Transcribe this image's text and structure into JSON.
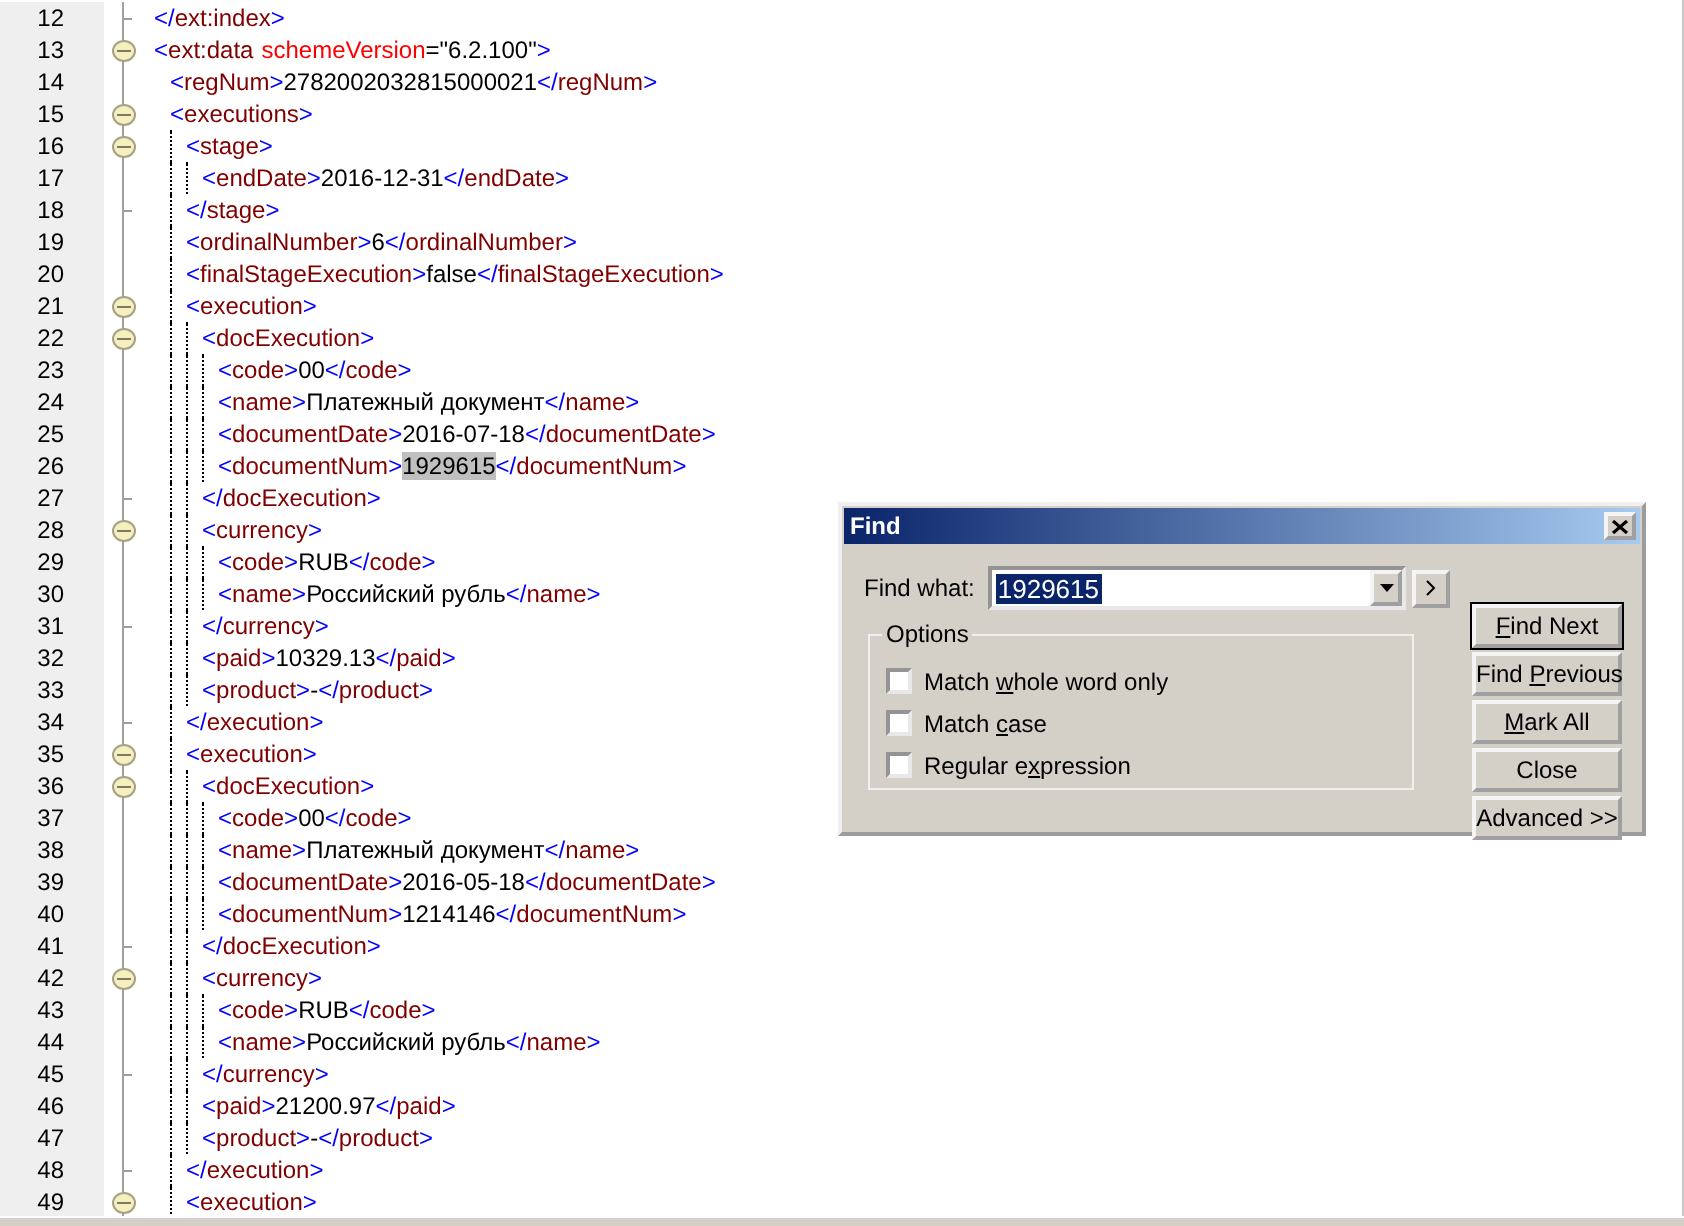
{
  "editor": {
    "lines": [
      {
        "number": "12",
        "kind": "end",
        "tokens": [
          {
            "kind": "bracket",
            "text": "</"
          },
          {
            "kind": "tag",
            "text": "ext:index"
          },
          {
            "kind": "bracket",
            "text": ">"
          }
        ]
      },
      {
        "number": "13",
        "kind": "block",
        "tokens": [
          {
            "kind": "bracket",
            "text": "<"
          },
          {
            "kind": "tag",
            "text": "ext:data"
          },
          {
            "kind": "attribute",
            "text": "schemeVersion"
          },
          {
            "kind": "value",
            "text": "=\"6.2.100\""
          },
          {
            "kind": "bracket",
            "text": ">"
          }
        ],
        "children": [
          {
            "number": "14",
            "kind": "line",
            "tokens": [
              {
                "kind": "bracket",
                "text": "<"
              },
              {
                "kind": "tag",
                "text": "regNum"
              },
              {
                "kind": "bracket",
                "text": ">"
              },
              {
                "kind": "text",
                "text": "2782002032815000021"
              },
              {
                "kind": "bracket",
                "text": "</"
              },
              {
                "kind": "tag",
                "text": "regNum"
              },
              {
                "kind": "bracket",
                "text": ">"
              }
            ]
          },
          {
            "number": "15",
            "kind": "block",
            "tokens": [
              {
                "kind": "bracket",
                "text": "<"
              },
              {
                "kind": "tag",
                "text": "executions"
              },
              {
                "kind": "bracket",
                "text": ">"
              }
            ],
            "children": [
              {
                "number": "16",
                "kind": "block",
                "tokens": [
                  {
                    "kind": "bracket",
                    "text": "<"
                  },
                  {
                    "kind": "tag",
                    "text": "stage"
                  },
                  {
                    "kind": "bracket",
                    "text": ">"
                  }
                ],
                "children": [
                  {
                    "number": "17",
                    "kind": "line",
                    "tokens": [
                      {
                        "kind": "bracket",
                        "text": "<"
                      },
                      {
                        "kind": "tag",
                        "text": "endDate"
                      },
                      {
                        "kind": "bracket",
                        "text": ">"
                      },
                      {
                        "kind": "text",
                        "text": "2016-12-31"
                      },
                      {
                        "kind": "bracket",
                        "text": "</"
                      },
                      {
                        "kind": "tag",
                        "text": "endDate"
                      },
                      {
                        "kind": "bracket",
                        "text": ">"
                      }
                    ]
                  }
                ],
                "close": {
                  "number": "18",
                  "kind": "end",
                  "tokens": [
                    {
                      "kind": "bracket",
                      "text": "</"
                    },
                    {
                      "kind": "tag",
                      "text": "stage"
                    },
                    {
                      "kind": "bracket",
                      "text": ">"
                    }
                  ]
                }
              },
              {
                "number": "19",
                "kind": "line",
                "tokens": [
                  {
                    "kind": "bracket",
                    "text": "<"
                  },
                  {
                    "kind": "tag",
                    "text": "ordinalNumber"
                  },
                  {
                    "kind": "bracket",
                    "text": ">"
                  },
                  {
                    "kind": "text",
                    "text": "6"
                  },
                  {
                    "kind": "bracket",
                    "text": "</"
                  },
                  {
                    "kind": "tag",
                    "text": "ordinalNumber"
                  },
                  {
                    "kind": "bracket",
                    "text": ">"
                  }
                ]
              },
              {
                "number": "20",
                "kind": "line",
                "tokens": [
                  {
                    "kind": "bracket",
                    "text": "<"
                  },
                  {
                    "kind": "tag",
                    "text": "finalStageExecution"
                  },
                  {
                    "kind": "bracket",
                    "text": ">"
                  },
                  {
                    "kind": "text",
                    "text": "false"
                  },
                  {
                    "kind": "bracket",
                    "text": "</"
                  },
                  {
                    "kind": "tag",
                    "text": "finalStageExecution"
                  },
                  {
                    "kind": "bracket",
                    "text": ">"
                  }
                ]
              },
              {
                "number": "21",
                "kind": "block",
                "tokens": [
                  {
                    "kind": "bracket",
                    "text": "<"
                  },
                  {
                    "kind": "tag",
                    "text": "execution"
                  },
                  {
                    "kind": "bracket",
                    "text": ">"
                  }
                ],
                "children": [
                  {
                    "number": "22",
                    "kind": "block",
                    "tokens": [
                      {
                        "kind": "bracket",
                        "text": "<"
                      },
                      {
                        "kind": "tag",
                        "text": "docExecution"
                      },
                      {
                        "kind": "bracket",
                        "text": ">"
                      }
                    ],
                    "children": [
                      {
                        "number": "23",
                        "kind": "line",
                        "tokens": [
                          {
                            "kind": "bracket",
                            "text": "<"
                          },
                          {
                            "kind": "tag",
                            "text": "code"
                          },
                          {
                            "kind": "bracket",
                            "text": ">"
                          },
                          {
                            "kind": "text",
                            "text": "00"
                          },
                          {
                            "kind": "bracket",
                            "text": "</"
                          },
                          {
                            "kind": "tag",
                            "text": "code"
                          },
                          {
                            "kind": "bracket",
                            "text": ">"
                          }
                        ]
                      },
                      {
                        "number": "24",
                        "kind": "line",
                        "tokens": [
                          {
                            "kind": "bracket",
                            "text": "<"
                          },
                          {
                            "kind": "tag",
                            "text": "name"
                          },
                          {
                            "kind": "bracket",
                            "text": ">"
                          },
                          {
                            "kind": "text",
                            "text": "Платежный документ"
                          },
                          {
                            "kind": "bracket",
                            "text": "</"
                          },
                          {
                            "kind": "tag",
                            "text": "name"
                          },
                          {
                            "kind": "bracket",
                            "text": ">"
                          }
                        ]
                      },
                      {
                        "number": "25",
                        "kind": "line",
                        "tokens": [
                          {
                            "kind": "bracket",
                            "text": "<"
                          },
                          {
                            "kind": "tag",
                            "text": "documentDate"
                          },
                          {
                            "kind": "bracket",
                            "text": ">"
                          },
                          {
                            "kind": "text",
                            "text": "2016-07-18"
                          },
                          {
                            "kind": "bracket",
                            "text": "</"
                          },
                          {
                            "kind": "tag",
                            "text": "documentDate"
                          },
                          {
                            "kind": "bracket",
                            "text": ">"
                          }
                        ]
                      },
                      {
                        "number": "26",
                        "kind": "line",
                        "tokens": [
                          {
                            "kind": "bracket",
                            "text": "<"
                          },
                          {
                            "kind": "tag",
                            "text": "documentNum"
                          },
                          {
                            "kind": "bracket",
                            "text": ">"
                          },
                          {
                            "kind": "match",
                            "text": "1929615"
                          },
                          {
                            "kind": "bracket",
                            "text": "</"
                          },
                          {
                            "kind": "tag",
                            "text": "documentNum"
                          },
                          {
                            "kind": "bracket",
                            "text": ">"
                          }
                        ]
                      }
                    ],
                    "close": {
                      "number": "27",
                      "kind": "end",
                      "tokens": [
                        {
                          "kind": "bracket",
                          "text": "</"
                        },
                        {
                          "kind": "tag",
                          "text": "docExecution"
                        },
                        {
                          "kind": "bracket",
                          "text": ">"
                        }
                      ]
                    }
                  },
                  {
                    "number": "28",
                    "kind": "block",
                    "tokens": [
                      {
                        "kind": "bracket",
                        "text": "<"
                      },
                      {
                        "kind": "tag",
                        "text": "currency"
                      },
                      {
                        "kind": "bracket",
                        "text": ">"
                      }
                    ],
                    "children": [
                      {
                        "number": "29",
                        "kind": "line",
                        "tokens": [
                          {
                            "kind": "bracket",
                            "text": "<"
                          },
                          {
                            "kind": "tag",
                            "text": "code"
                          },
                          {
                            "kind": "bracket",
                            "text": ">"
                          },
                          {
                            "kind": "text",
                            "text": "RUB"
                          },
                          {
                            "kind": "bracket",
                            "text": "</"
                          },
                          {
                            "kind": "tag",
                            "text": "code"
                          },
                          {
                            "kind": "bracket",
                            "text": ">"
                          }
                        ]
                      },
                      {
                        "number": "30",
                        "kind": "line",
                        "tokens": [
                          {
                            "kind": "bracket",
                            "text": "<"
                          },
                          {
                            "kind": "tag",
                            "text": "name"
                          },
                          {
                            "kind": "bracket",
                            "text": ">"
                          },
                          {
                            "kind": "text",
                            "text": "Российский рубль"
                          },
                          {
                            "kind": "bracket",
                            "text": "</"
                          },
                          {
                            "kind": "tag",
                            "text": "name"
                          },
                          {
                            "kind": "bracket",
                            "text": ">"
                          }
                        ]
                      }
                    ],
                    "close": {
                      "number": "31",
                      "kind": "end",
                      "tokens": [
                        {
                          "kind": "bracket",
                          "text": "</"
                        },
                        {
                          "kind": "tag",
                          "text": "currency"
                        },
                        {
                          "kind": "bracket",
                          "text": ">"
                        }
                      ]
                    }
                  },
                  {
                    "number": "32",
                    "kind": "line",
                    "tokens": [
                      {
                        "kind": "bracket",
                        "text": "<"
                      },
                      {
                        "kind": "tag",
                        "text": "paid"
                      },
                      {
                        "kind": "bracket",
                        "text": ">"
                      },
                      {
                        "kind": "text",
                        "text": "10329.13"
                      },
                      {
                        "kind": "bracket",
                        "text": "</"
                      },
                      {
                        "kind": "tag",
                        "text": "paid"
                      },
                      {
                        "kind": "bracket",
                        "text": ">"
                      }
                    ]
                  },
                  {
                    "number": "33",
                    "kind": "line",
                    "tokens": [
                      {
                        "kind": "bracket",
                        "text": "<"
                      },
                      {
                        "kind": "tag",
                        "text": "product"
                      },
                      {
                        "kind": "bracket",
                        "text": ">"
                      },
                      {
                        "kind": "text",
                        "text": "-"
                      },
                      {
                        "kind": "bracket",
                        "text": "</"
                      },
                      {
                        "kind": "tag",
                        "text": "product"
                      },
                      {
                        "kind": "bracket",
                        "text": ">"
                      }
                    ]
                  }
                ],
                "close": {
                  "number": "34",
                  "kind": "end",
                  "tokens": [
                    {
                      "kind": "bracket",
                      "text": "</"
                    },
                    {
                      "kind": "tag",
                      "text": "execution"
                    },
                    {
                      "kind": "bracket",
                      "text": ">"
                    }
                  ]
                }
              },
              {
                "number": "35",
                "kind": "block",
                "tokens": [
                  {
                    "kind": "bracket",
                    "text": "<"
                  },
                  {
                    "kind": "tag",
                    "text": "execution"
                  },
                  {
                    "kind": "bracket",
                    "text": ">"
                  }
                ],
                "children": [
                  {
                    "number": "36",
                    "kind": "block",
                    "tokens": [
                      {
                        "kind": "bracket",
                        "text": "<"
                      },
                      {
                        "kind": "tag",
                        "text": "docExecution"
                      },
                      {
                        "kind": "bracket",
                        "text": ">"
                      }
                    ],
                    "children": [
                      {
                        "number": "37",
                        "kind": "line",
                        "tokens": [
                          {
                            "kind": "bracket",
                            "text": "<"
                          },
                          {
                            "kind": "tag",
                            "text": "code"
                          },
                          {
                            "kind": "bracket",
                            "text": ">"
                          },
                          {
                            "kind": "text",
                            "text": "00"
                          },
                          {
                            "kind": "bracket",
                            "text": "</"
                          },
                          {
                            "kind": "tag",
                            "text": "code"
                          },
                          {
                            "kind": "bracket",
                            "text": ">"
                          }
                        ]
                      },
                      {
                        "number": "38",
                        "kind": "line",
                        "tokens": [
                          {
                            "kind": "bracket",
                            "text": "<"
                          },
                          {
                            "kind": "tag",
                            "text": "name"
                          },
                          {
                            "kind": "bracket",
                            "text": ">"
                          },
                          {
                            "kind": "text",
                            "text": "Платежный документ"
                          },
                          {
                            "kind": "bracket",
                            "text": "</"
                          },
                          {
                            "kind": "tag",
                            "text": "name"
                          },
                          {
                            "kind": "bracket",
                            "text": ">"
                          }
                        ]
                      },
                      {
                        "number": "39",
                        "kind": "line",
                        "tokens": [
                          {
                            "kind": "bracket",
                            "text": "<"
                          },
                          {
                            "kind": "tag",
                            "text": "documentDate"
                          },
                          {
                            "kind": "bracket",
                            "text": ">"
                          },
                          {
                            "kind": "text",
                            "text": "2016-05-18"
                          },
                          {
                            "kind": "bracket",
                            "text": "</"
                          },
                          {
                            "kind": "tag",
                            "text": "documentDate"
                          },
                          {
                            "kind": "bracket",
                            "text": ">"
                          }
                        ]
                      },
                      {
                        "number": "40",
                        "kind": "line",
                        "tokens": [
                          {
                            "kind": "bracket",
                            "text": "<"
                          },
                          {
                            "kind": "tag",
                            "text": "documentNum"
                          },
                          {
                            "kind": "bracket",
                            "text": ">"
                          },
                          {
                            "kind": "text",
                            "text": "1214146"
                          },
                          {
                            "kind": "bracket",
                            "text": "</"
                          },
                          {
                            "kind": "tag",
                            "text": "documentNum"
                          },
                          {
                            "kind": "bracket",
                            "text": ">"
                          }
                        ]
                      }
                    ],
                    "close": {
                      "number": "41",
                      "kind": "end",
                      "tokens": [
                        {
                          "kind": "bracket",
                          "text": "</"
                        },
                        {
                          "kind": "tag",
                          "text": "docExecution"
                        },
                        {
                          "kind": "bracket",
                          "text": ">"
                        }
                      ]
                    }
                  },
                  {
                    "number": "42",
                    "kind": "block",
                    "tokens": [
                      {
                        "kind": "bracket",
                        "text": "<"
                      },
                      {
                        "kind": "tag",
                        "text": "currency"
                      },
                      {
                        "kind": "bracket",
                        "text": ">"
                      }
                    ],
                    "children": [
                      {
                        "number": "43",
                        "kind": "line",
                        "tokens": [
                          {
                            "kind": "bracket",
                            "text": "<"
                          },
                          {
                            "kind": "tag",
                            "text": "code"
                          },
                          {
                            "kind": "bracket",
                            "text": ">"
                          },
                          {
                            "kind": "text",
                            "text": "RUB"
                          },
                          {
                            "kind": "bracket",
                            "text": "</"
                          },
                          {
                            "kind": "tag",
                            "text": "code"
                          },
                          {
                            "kind": "bracket",
                            "text": ">"
                          }
                        ]
                      },
                      {
                        "number": "44",
                        "kind": "line",
                        "tokens": [
                          {
                            "kind": "bracket",
                            "text": "<"
                          },
                          {
                            "kind": "tag",
                            "text": "name"
                          },
                          {
                            "kind": "bracket",
                            "text": ">"
                          },
                          {
                            "kind": "text",
                            "text": "Российский рубль"
                          },
                          {
                            "kind": "bracket",
                            "text": "</"
                          },
                          {
                            "kind": "tag",
                            "text": "name"
                          },
                          {
                            "kind": "bracket",
                            "text": ">"
                          }
                        ]
                      }
                    ],
                    "close": {
                      "number": "45",
                      "kind": "end",
                      "tokens": [
                        {
                          "kind": "bracket",
                          "text": "</"
                        },
                        {
                          "kind": "tag",
                          "text": "currency"
                        },
                        {
                          "kind": "bracket",
                          "text": ">"
                        }
                      ]
                    }
                  },
                  {
                    "number": "46",
                    "kind": "line",
                    "tokens": [
                      {
                        "kind": "bracket",
                        "text": "<"
                      },
                      {
                        "kind": "tag",
                        "text": "paid"
                      },
                      {
                        "kind": "bracket",
                        "text": ">"
                      },
                      {
                        "kind": "text",
                        "text": "21200.97"
                      },
                      {
                        "kind": "bracket",
                        "text": "</"
                      },
                      {
                        "kind": "tag",
                        "text": "paid"
                      },
                      {
                        "kind": "bracket",
                        "text": ">"
                      }
                    ]
                  },
                  {
                    "number": "47",
                    "kind": "line",
                    "tokens": [
                      {
                        "kind": "bracket",
                        "text": "<"
                      },
                      {
                        "kind": "tag",
                        "text": "product"
                      },
                      {
                        "kind": "bracket",
                        "text": ">"
                      },
                      {
                        "kind": "text",
                        "text": "-"
                      },
                      {
                        "kind": "bracket",
                        "text": "</"
                      },
                      {
                        "kind": "tag",
                        "text": "product"
                      },
                      {
                        "kind": "bracket",
                        "text": ">"
                      }
                    ]
                  }
                ],
                "close": {
                  "number": "48",
                  "kind": "end",
                  "tokens": [
                    {
                      "kind": "bracket",
                      "text": "</"
                    },
                    {
                      "kind": "tag",
                      "text": "execution"
                    },
                    {
                      "kind": "bracket",
                      "text": ">"
                    }
                  ]
                }
              },
              {
                "number": "49",
                "kind": "block",
                "tokens": [
                  {
                    "kind": "bracket",
                    "text": "<"
                  },
                  {
                    "kind": "tag",
                    "text": "execution"
                  },
                  {
                    "kind": "bracket",
                    "text": ">"
                  }
                ]
              }
            ]
          }
        ]
      }
    ]
  },
  "find_dialog": {
    "title": "Find",
    "find_label": "Find what:",
    "find_field": {
      "value": "1929615",
      "highlighted": true
    },
    "options_label": "Options",
    "options": [
      {
        "label": "Match ",
        "access_key": "w",
        "label_rest": "hole word only",
        "checked": false
      },
      {
        "label": "Match ",
        "access_key": "c",
        "label_rest": "ase",
        "checked": false
      },
      {
        "label": "Regular e",
        "access_key": "x",
        "label_rest": "pression",
        "checked": false
      }
    ],
    "buttons": [
      {
        "access_key": "F",
        "label_rest": "ind Next",
        "default": true
      },
      {
        "label": "Find ",
        "access_key": "P",
        "label_rest": "revious",
        "default": false
      },
      {
        "access_key": "M",
        "label_rest": "ark All",
        "default": false
      },
      {
        "label": "Close",
        "default": false
      },
      {
        "label": "Advanced >>",
        "default": false
      }
    ]
  }
}
